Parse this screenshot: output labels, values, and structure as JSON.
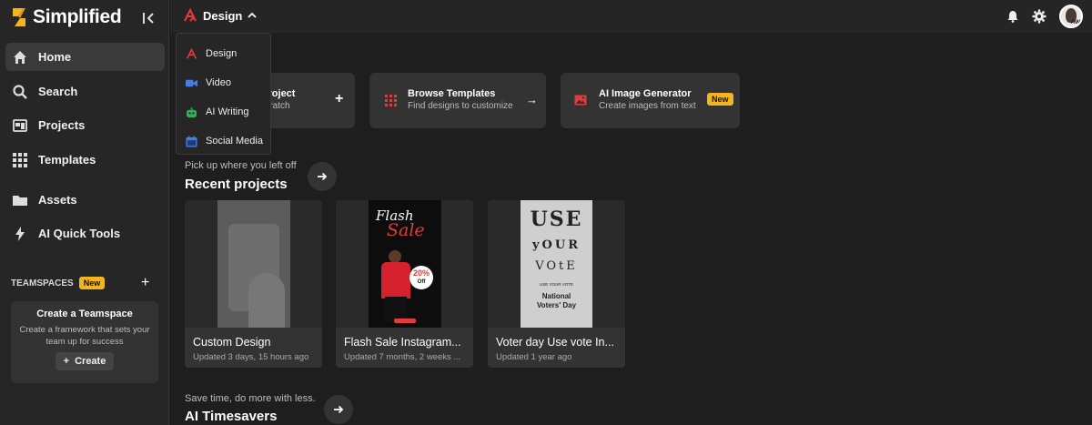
{
  "app": {
    "name": "Simplified"
  },
  "sidebar": {
    "items": [
      {
        "label": "Home",
        "icon": "home-icon",
        "active": true
      },
      {
        "label": "Search",
        "icon": "search-icon"
      },
      {
        "label": "Projects",
        "icon": "projects-icon"
      },
      {
        "label": "Templates",
        "icon": "templates-grid-icon"
      },
      {
        "label": "Assets",
        "icon": "folder-icon"
      },
      {
        "label": "AI Quick Tools",
        "icon": "lightning-icon"
      }
    ],
    "teamspaces_label": "TEAMSPACES",
    "new_badge": "New",
    "teamspace_card": {
      "title": "Create a Teamspace",
      "description": "Create a framework that sets your team up for success",
      "button": "Create"
    }
  },
  "topbar": {
    "design_label": "Design",
    "avatar_initials": "AW"
  },
  "dropdown": {
    "items": [
      {
        "label": "Design",
        "icon": "design-icon",
        "color": "#e23b3b"
      },
      {
        "label": "Video",
        "icon": "video-icon",
        "color": "#4a7de0"
      },
      {
        "label": "AI Writing",
        "icon": "ai-writing-icon",
        "color": "#2fae5a"
      },
      {
        "label": "Social Media",
        "icon": "social-media-icon",
        "color": "#4a7de0"
      }
    ]
  },
  "quick_actions": [
    {
      "title": "k Project",
      "subtitle": "n scratch",
      "action": "+"
    },
    {
      "title": "Browse Templates",
      "subtitle": "Find designs to customize",
      "action": "→"
    },
    {
      "title": "AI Image Generator",
      "subtitle": "Create images from text",
      "badge": "New"
    }
  ],
  "recent": {
    "hint": "Pick up where you left off",
    "title": "Recent projects",
    "projects": [
      {
        "name": "Custom Design",
        "meta": "Updated 3 days, 15 hours ago"
      },
      {
        "name": "Flash Sale Instagram...",
        "meta": "Updated 7 months, 2 weeks ...",
        "thumb_title": "Flash",
        "thumb_sub": "Sale",
        "thumb_badge_pct": "20%",
        "thumb_badge_off": "Off"
      },
      {
        "name": "Voter day Use vote In...",
        "meta": "Updated 1 year ago",
        "thumb_lines": [
          "USE",
          "yOUR",
          "VOtE"
        ],
        "thumb_small": "USE YOUR VOTE",
        "thumb_title": "National Voters' Day"
      }
    ]
  },
  "timesavers": {
    "hint": "Save time, do more with less.",
    "title": "AI Timesavers"
  },
  "colors": {
    "accent_yellow": "#f2b51f",
    "brand_red": "#e23b3b",
    "background": "#1e1e1e",
    "sidebar": "#262626",
    "card": "#333333"
  }
}
